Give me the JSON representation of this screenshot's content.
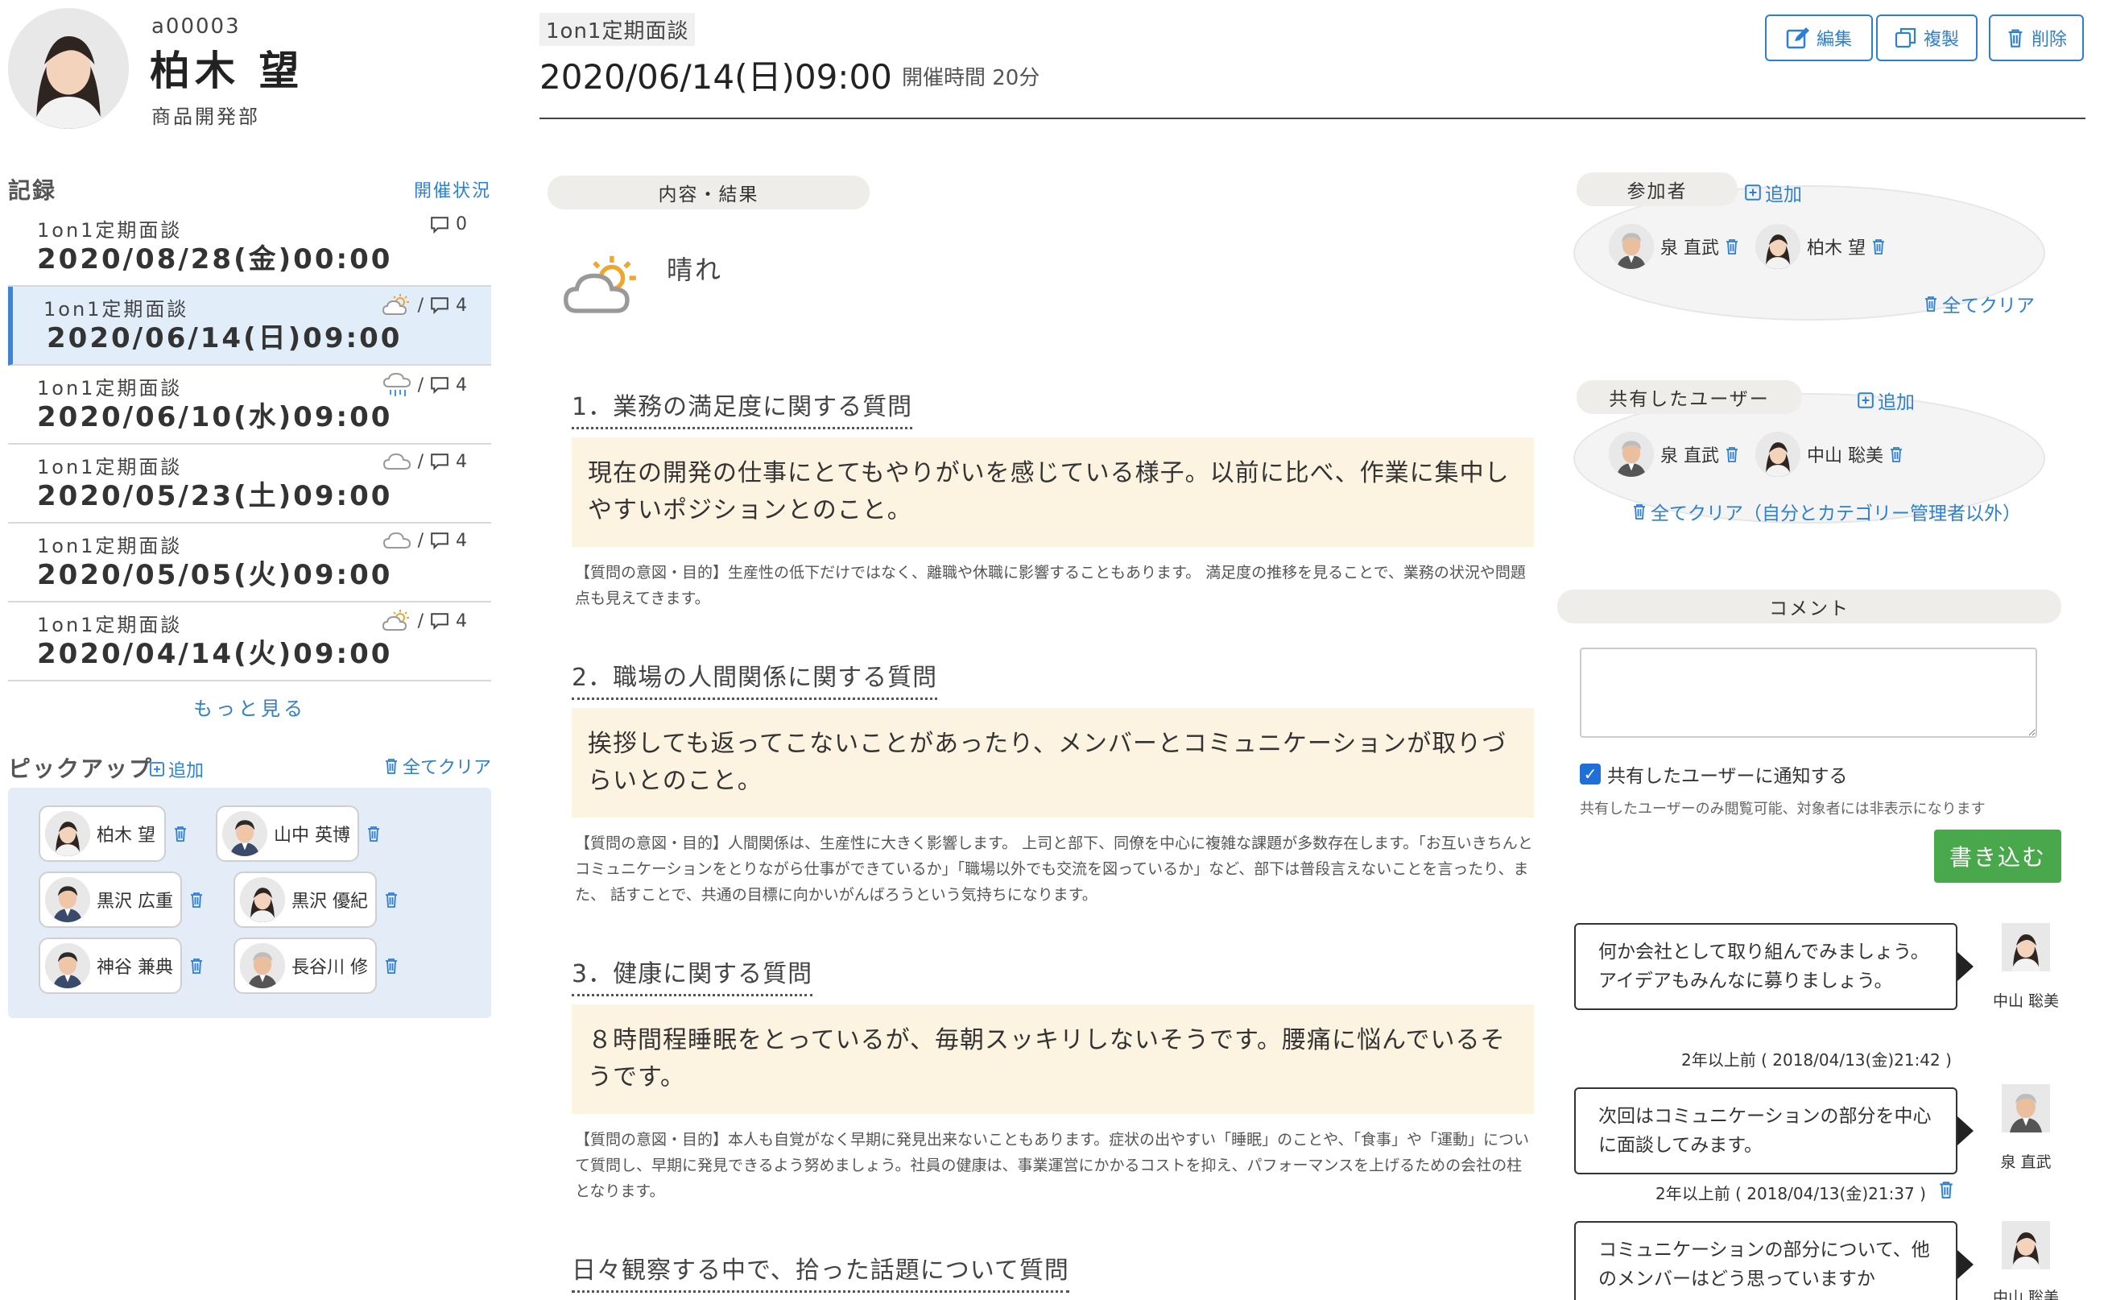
{
  "profile": {
    "employee_id": "a00003",
    "name": "柏木 望",
    "department": "商品開発部"
  },
  "records": {
    "title": "記録",
    "status_link": "開催状況",
    "items": [
      {
        "type": "1on1定期面談",
        "date": "2020/08/28(金)00:00",
        "weather": "none",
        "sep": "",
        "comments": "0"
      },
      {
        "type": "1on1定期面談",
        "date": "2020/06/14(日)09:00",
        "weather": "sunny-cloudy-icon",
        "sep": "/",
        "comments": "4"
      },
      {
        "type": "1on1定期面談",
        "date": "2020/06/10(水)09:00",
        "weather": "rain-icon",
        "sep": "/",
        "comments": "4"
      },
      {
        "type": "1on1定期面談",
        "date": "2020/05/23(土)09:00",
        "weather": "cloud-icon",
        "sep": "/",
        "comments": "4"
      },
      {
        "type": "1on1定期面談",
        "date": "2020/05/05(火)09:00",
        "weather": "cloud-icon",
        "sep": "/",
        "comments": "4"
      },
      {
        "type": "1on1定期面談",
        "date": "2020/04/14(火)09:00",
        "weather": "sunny-cloudy-icon",
        "sep": "/",
        "comments": "4"
      }
    ],
    "more": "もっと見る"
  },
  "pickup": {
    "title": "ピックアップ",
    "add": "追加",
    "clear": "全てクリア",
    "people": [
      "柏木 望",
      "山中 英博",
      "黒沢 広重",
      "黒沢 優紀",
      "神谷 兼典",
      "長谷川 修"
    ]
  },
  "meeting": {
    "type": "1on1定期面談",
    "datetime": "2020/06/14(日)09:00",
    "duration": "開催時間 20分",
    "buttons": {
      "edit": "編集",
      "copy": "複製",
      "delete": "削除"
    },
    "section_label": "内容・結果",
    "weather_label": "晴れ",
    "questions": [
      {
        "title": "1．業務の満足度に関する質問",
        "answer": "現在の開発の仕事にとてもやりがいを感じている様子。以前に比べ、作業に集中しやすいポジションとのこと。",
        "note": "【質問の意図・目的】生産性の低下だけではなく、離職や休職に影響することもあります。 満足度の推移を見ることで、業務の状況や問題点も見えてきます。"
      },
      {
        "title": "2．職場の人間関係に関する質問",
        "answer": "挨拶しても返ってこないことがあったり、メンバーとコミュニケーションが取りづらいとのこと。",
        "note": "【質問の意図・目的】人間関係は、生産性に大きく影響します。 上司と部下、同僚を中心に複雑な課題が多数存在します。「お互いきちんとコミュニケーションをとりながら仕事ができているか」「職場以外でも交流を図っているか」など、部下は普段言えないことを言ったり、また、 話すことで、共通の目標に向かいがんばろうという気持ちになります。"
      },
      {
        "title": "3．健康に関する質問",
        "answer": "８時間程睡眠をとっているが、毎朝スッキリしないそうです。腰痛に悩んでいるそうです。",
        "note": "【質問の意図・目的】本人も自覚がなく早期に発見出来ないこともあります。症状の出やすい「睡眠」のことや、「食事」や「運動」について質問し、早期に発見できるよう努めましょう。社員の健康は、事業運営にかかるコストを抑え、パフォーマンスを上げるための会社の柱となります。"
      },
      {
        "title": "日々観察する中で、拾った話題について質問",
        "answer": "",
        "note": ""
      }
    ]
  },
  "participants": {
    "label": "参加者",
    "add": "追加",
    "people": [
      "泉 直武",
      "柏木 望"
    ],
    "clear": "全てクリア"
  },
  "shared_users": {
    "label": "共有したユーザー",
    "add": "追加",
    "people": [
      "泉 直武",
      "中山 聡美"
    ],
    "clear": "全てクリア（自分とカテゴリー管理者以外）"
  },
  "comment_form": {
    "label": "コメント",
    "value": "",
    "notify_label": "共有したユーザーに通知する",
    "notify_checked": true,
    "help": "共有したユーザーのみ閲覧可能、対象者には非表示になります",
    "submit": "書き込む"
  },
  "comments": [
    {
      "text": "何か会社として取り組んでみましょう。アイデアもみんなに募りましょう。",
      "author": "中山 聡美",
      "time": "2年以上前 ( 2018/04/13(金)21:42 )"
    },
    {
      "text": "次回はコミュニケーションの部分を中心に面談してみます。",
      "author": "泉 直武",
      "time": "2年以上前 ( 2018/04/13(金)21:37 )"
    },
    {
      "text": "コミュニケーションの部分について、他のメンバーはどう思っていますか",
      "author": "中山 聡美",
      "time": ""
    }
  ],
  "colors": {
    "accent": "#2d7fd3",
    "active_row": "#e1edf9",
    "answer_bg": "#fdf3e1",
    "submit": "#4aa84c"
  }
}
